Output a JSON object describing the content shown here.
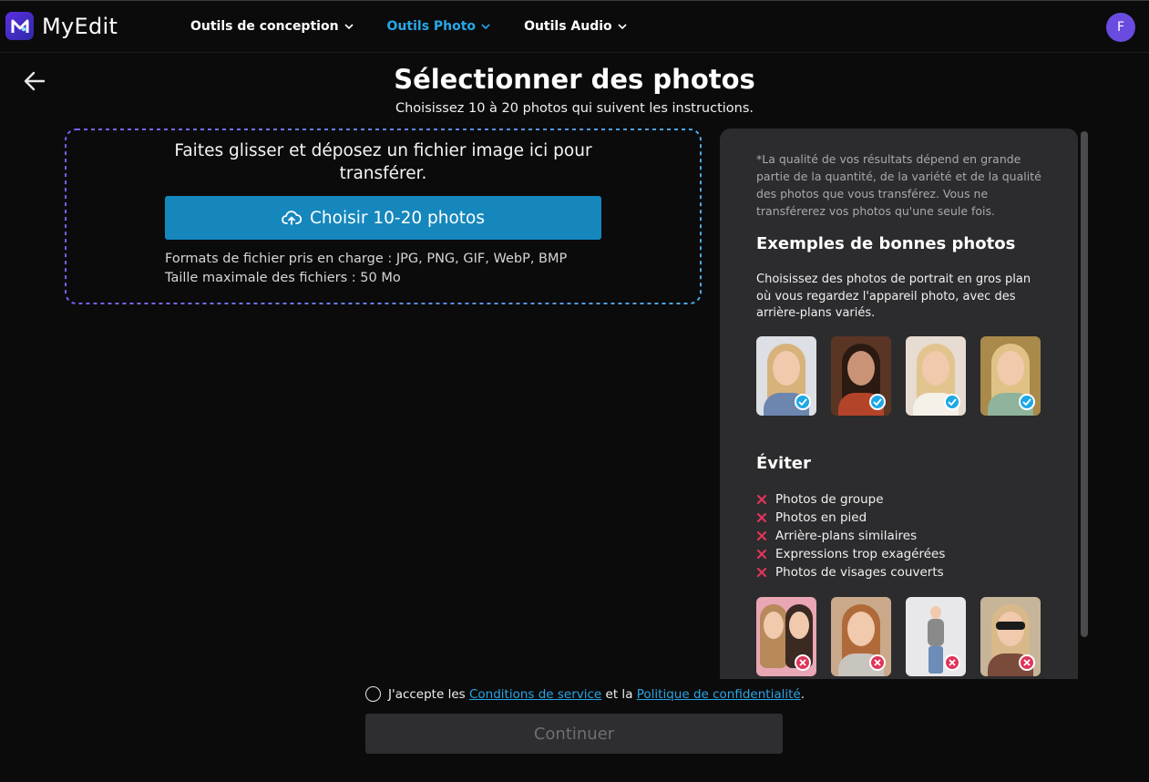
{
  "brand": {
    "name": "MyEdit"
  },
  "nav": {
    "items": [
      {
        "label": "Outils de conception"
      },
      {
        "label": "Outils Photo"
      },
      {
        "label": "Outils Audio"
      }
    ]
  },
  "user": {
    "initial": "F"
  },
  "page": {
    "title": "Sélectionner des photos",
    "subtitle": "Choisissez 10 à 20 photos qui suivent les instructions."
  },
  "dropzone": {
    "text_line1": "Faites glisser et déposez un fichier image ici pour",
    "text_line2": "transférer.",
    "button_label": "Choisir 10-20 photos",
    "formats": "Formats de fichier pris en charge : JPG, PNG, GIF, WebP, BMP",
    "max_size": "Taille maximale des fichiers : 50 Mo"
  },
  "panel": {
    "note": "*La qualité de vos résultats dépend en grande partie de la quantité, de la variété et de la qualité des photos que vous transférez. Vous ne transférerez vos photos qu'une seule fois.",
    "good_heading": "Exemples de bonnes photos",
    "good_desc": "Choisissez des photos de portrait en gros plan où vous regardez l'appareil photo, avec des arrière-plans variés.",
    "avoid_heading": "Éviter",
    "avoid_items": [
      "Photos de groupe",
      "Photos en pied",
      "Arrière-plans similaires",
      "Expressions trop exagérées",
      "Photos de visages couverts"
    ]
  },
  "terms": {
    "prefix": "J'accepte les",
    "link1": "Conditions de service",
    "middle": "et la",
    "link2": "Politique de confidentialité",
    "suffix": "."
  },
  "continue_label": "Continuer",
  "colors": {
    "background": "#0b0b0c",
    "accent": "#1587bd",
    "active_nav": "#27a8e8",
    "panel": "#2c2c2e",
    "ok_badge": "#1ea8e6",
    "error_mark": "#e0355a"
  }
}
